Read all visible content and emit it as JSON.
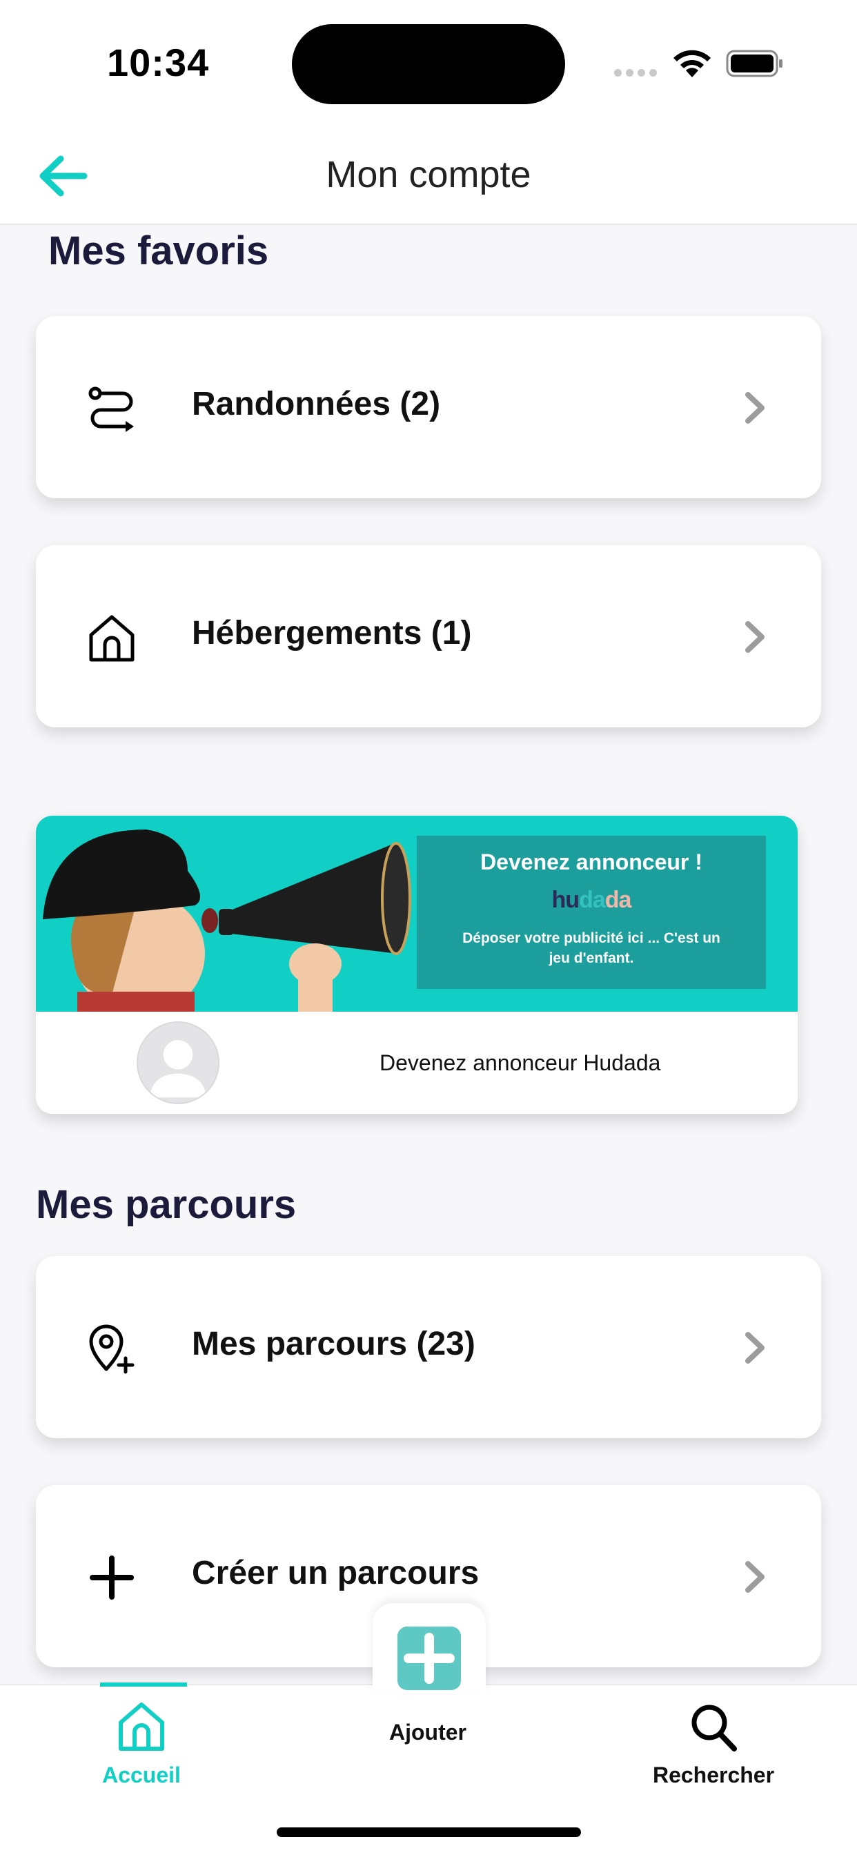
{
  "status_bar": {
    "time": "10:34"
  },
  "header": {
    "title": "Mon compte",
    "back_icon": "arrow-left-icon"
  },
  "favorites": {
    "title": "Mes favoris",
    "items": [
      {
        "label": "Randonnées (2)",
        "icon": "route-icon"
      },
      {
        "label": "Hébergements (1)",
        "icon": "house-icon"
      }
    ]
  },
  "ad": {
    "headline": "Devenez annonceur !",
    "brand_parts": [
      "hu",
      "da",
      "da"
    ],
    "subtext": "Déposer votre publicité ici ... C'est un jeu d'enfant.",
    "caption": "Devenez annonceur Hudada"
  },
  "routes": {
    "title": "Mes parcours",
    "items": [
      {
        "label": "Mes parcours (23)",
        "icon": "map-pin-plus-icon"
      },
      {
        "label": "Créer un parcours",
        "icon": "plus-icon"
      }
    ]
  },
  "tabbar": {
    "home": "Accueil",
    "add": "Ajouter",
    "search": "Rechercher"
  },
  "colors": {
    "accent": "#11cfc4",
    "title": "#1c1b3b",
    "ad_panel": "#1c9e9c"
  }
}
